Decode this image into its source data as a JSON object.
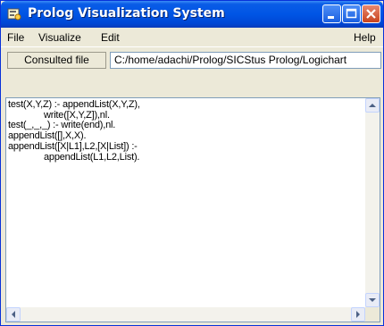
{
  "window": {
    "title": "Prolog Visualization System",
    "app_icon": "app-icon",
    "controls": [
      "minimize-icon",
      "maximize-icon",
      "close-icon"
    ]
  },
  "menu": {
    "file": "File",
    "visualize": "Visualize",
    "edit": "Edit",
    "help": "Help"
  },
  "consulted": {
    "label": "Consulted file",
    "path": "C:/home/adachi/Prolog/SICStus Prolog/Logichart"
  },
  "editor": {
    "code": "test(X,Y,Z) :- appendList(X,Y,Z),\n              write([X,Y,Z]),nl.\ntest(_,_,_) :- write(end),nl.\nappendList([],X,X).\nappendList([X|L1],L2,[X|List]) :-\n              appendList(L1,L2,List)."
  },
  "colors": {
    "titlebar": "#0055e5",
    "window_bg": "#ece9d8",
    "close_button": "#c8431d"
  }
}
